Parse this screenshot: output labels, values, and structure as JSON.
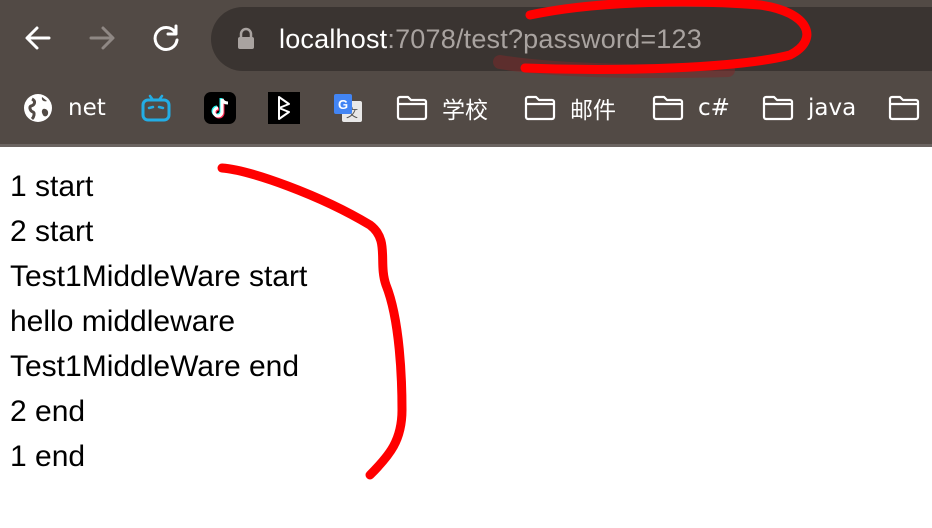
{
  "browser": {
    "nav": {
      "back_icon": "arrow-left-icon",
      "forward_icon": "arrow-right-icon",
      "reload_icon": "reload-icon"
    },
    "address_bar": {
      "host": "localhost",
      "rest": ":7078/test?password=123",
      "lock_icon": "lock-icon"
    },
    "bookmarks": [
      {
        "label": "net",
        "icon": "globe-icon"
      },
      {
        "label": "",
        "icon": "bilibili-icon"
      },
      {
        "label": "",
        "icon": "tiktok-icon"
      },
      {
        "label": "",
        "icon": "app-logo-icon"
      },
      {
        "label": "",
        "icon": "google-translate-icon"
      },
      {
        "label": "学校",
        "icon": "folder-icon"
      },
      {
        "label": "邮件",
        "icon": "folder-icon"
      },
      {
        "label": "c#",
        "icon": "folder-icon"
      },
      {
        "label": "java",
        "icon": "folder-icon"
      },
      {
        "label": "",
        "icon": "folder-icon"
      }
    ]
  },
  "page": {
    "lines": [
      "1 start",
      "2 start",
      "Test1MiddleWare start",
      "hello middleware",
      "Test1MiddleWare end",
      "2 end",
      "1 end"
    ]
  },
  "colors": {
    "toolbar": "#524a45",
    "omnibox": "#3a3431",
    "annotation": "#ff0000"
  }
}
